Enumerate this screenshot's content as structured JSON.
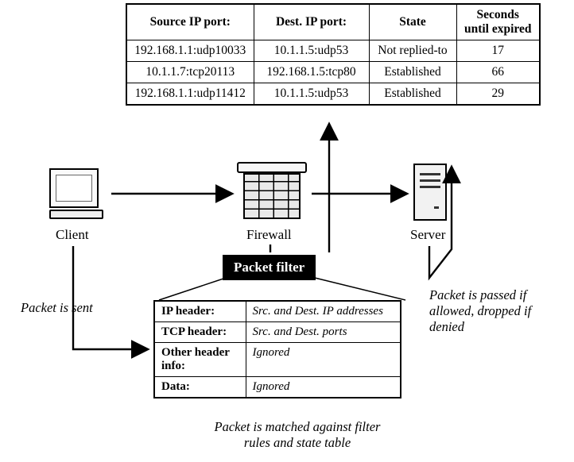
{
  "state_table": {
    "headers": [
      "Source IP port:",
      "Dest. IP port:",
      "State",
      "Seconds until expired"
    ],
    "rows": [
      [
        "192.168.1.1:udp10033",
        "10.1.1.5:udp53",
        "Not replied-to",
        "17"
      ],
      [
        "10.1.1.7:tcp20113",
        "192.168.1.5:tcp80",
        "Established",
        "66"
      ],
      [
        "192.168.1.1:udp11412",
        "10.1.1.5:udp53",
        "Established",
        "29"
      ]
    ]
  },
  "devices": {
    "client": "Client",
    "firewall": "Firewall",
    "server": "Server"
  },
  "packet_filter_label": "Packet filter",
  "packet_table": {
    "rows": [
      [
        "IP header:",
        "Src. and Dest. IP addresses"
      ],
      [
        "TCP header:",
        "Src. and Dest. ports"
      ],
      [
        "Other header info:",
        "Ignored"
      ],
      [
        "Data:",
        "Ignored"
      ]
    ]
  },
  "captions": {
    "sent": "Packet is sent",
    "passed": "Packet is passed if allowed, dropped if denied",
    "matched": "Packet is matched against filter rules and state table"
  }
}
